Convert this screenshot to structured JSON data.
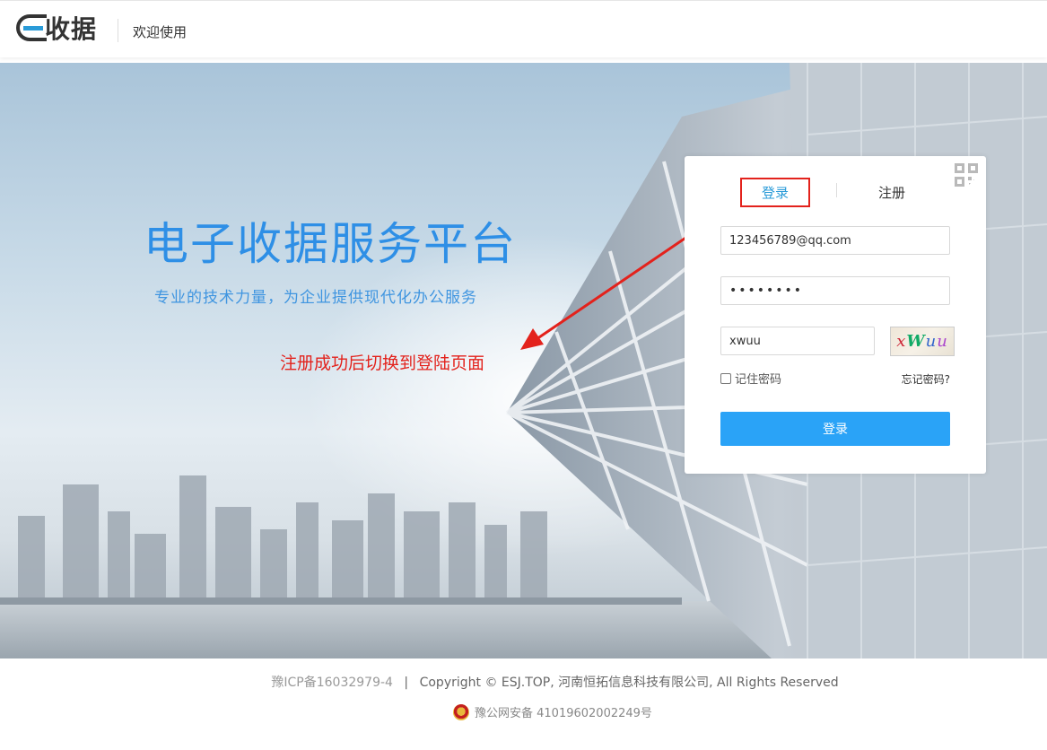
{
  "header": {
    "logo_text": "收据",
    "welcome": "欢迎使用"
  },
  "hero": {
    "title": "电子收据服务平台",
    "subtitle": "专业的技术力量，为企业提供现代化办公服务",
    "annotation": "注册成功后切换到登陆页面"
  },
  "login": {
    "tab_login": "登录",
    "tab_register": "注册",
    "email_value": "123456789@qq.com",
    "password_value": "••••••••",
    "captcha_value": "xwuu",
    "captcha_chars": [
      "x",
      "W",
      "u",
      "u"
    ],
    "remember_label": "记住密码",
    "forgot_label": "忘记密码?",
    "submit_label": "登录",
    "accent_color": "#2aa3f7"
  },
  "footer": {
    "icp": "豫ICP备16032979-4",
    "separator": "|",
    "copyright": "Copyright © ESJ.TOP, 河南恒拓信息科技有限公司, All Rights Reserved",
    "police_record": "豫公网安备 41019602002249号"
  }
}
